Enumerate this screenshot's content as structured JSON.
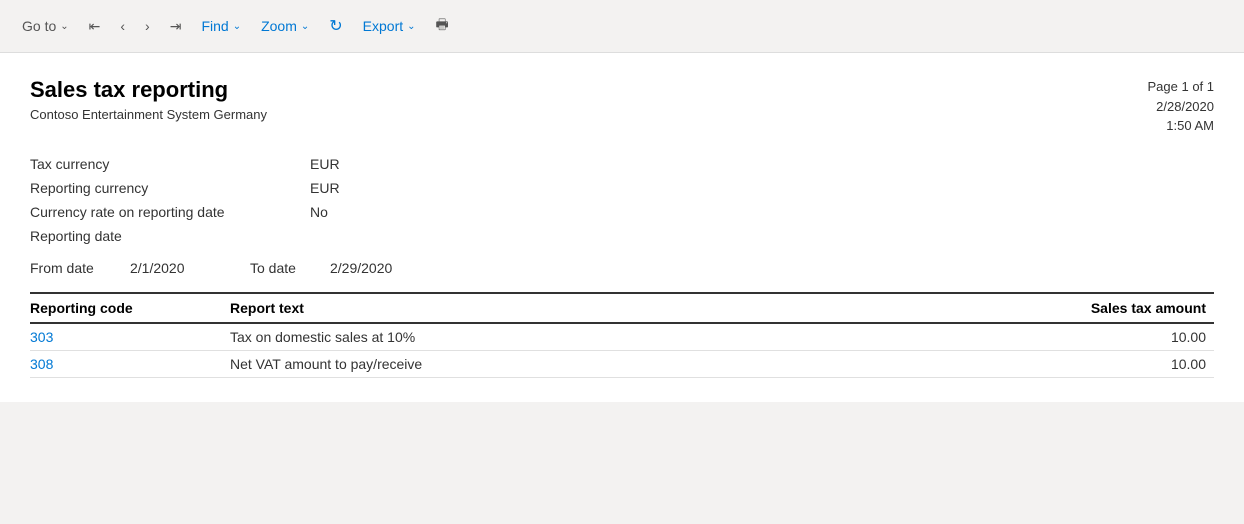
{
  "toolbar": {
    "goto_label": "Go to",
    "find_label": "Find",
    "zoom_label": "Zoom",
    "export_label": "Export",
    "chevron": "∨"
  },
  "report": {
    "title": "Sales tax reporting",
    "company": "Contoso Entertainment System Germany",
    "page_info_line1": "Page 1 of 1",
    "page_info_line2": "2/28/2020",
    "page_info_line3": "1:50 AM",
    "meta_fields": [
      {
        "label": "Tax currency",
        "value": "EUR"
      },
      {
        "label": "Reporting currency",
        "value": "EUR"
      },
      {
        "label": "Currency rate on reporting date",
        "value": "No"
      },
      {
        "label": "Reporting date",
        "value": ""
      }
    ],
    "from_date_label": "From date",
    "from_date_value": "2/1/2020",
    "to_date_label": "To date",
    "to_date_value": "2/29/2020",
    "table": {
      "columns": [
        {
          "key": "code",
          "label": "Reporting code",
          "align": "left"
        },
        {
          "key": "text",
          "label": "Report text",
          "align": "left"
        },
        {
          "key": "amount",
          "label": "Sales tax amount",
          "align": "right"
        }
      ],
      "rows": [
        {
          "code": "303",
          "text": "Tax on domestic sales at 10%",
          "amount": "10.00"
        },
        {
          "code": "308",
          "text": "Net VAT amount to pay/receive",
          "amount": "10.00"
        }
      ]
    }
  }
}
